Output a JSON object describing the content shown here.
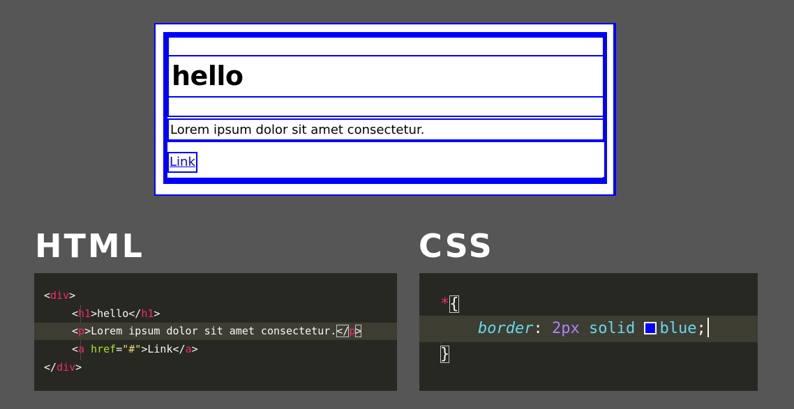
{
  "preview": {
    "heading": "hello",
    "paragraph": "Lorem ipsum dolor sit amet consectetur.",
    "link": "Link"
  },
  "sections": {
    "html_title": "HTML",
    "css_title": "CSS"
  },
  "html_code": {
    "line1": {
      "open": "<",
      "tag": "div",
      "close": ">"
    },
    "line2": {
      "open": "<",
      "tag": "h1",
      "close": ">",
      "text": "hello",
      "end_open": "</",
      "end_tag": "h1",
      "end_close": ">"
    },
    "line3": {
      "open": "<",
      "tag": "p",
      "close": ">",
      "text": "Lorem ipsum dolor sit amet consectetur.",
      "end_open": "</",
      "end_tag": "p",
      "end_close": ">"
    },
    "line4": {
      "open": "<",
      "tag": "a",
      "attr": " href",
      "eq": "=",
      "str": "\"#\"",
      "close": ">",
      "text": "Link",
      "end_open": "</",
      "end_tag": "a",
      "end_close": ">"
    },
    "line5": {
      "open": "</",
      "tag": "div",
      "close": ">"
    }
  },
  "css_code": {
    "selector": "*",
    "open_brace": "{",
    "property": "border",
    "colon": ":",
    "num": "2px",
    "keyword": "solid",
    "color_value": "blue",
    "semicolon": ";",
    "close_brace": "}"
  },
  "colors": {
    "background": "#565656",
    "editor_bg": "#272822",
    "border_blue": "#0000ff",
    "tag_pink": "#f92672",
    "attr_green": "#a6e22e",
    "string_yellow": "#e6db74",
    "prop_cyan": "#66d9ef",
    "number_purple": "#ae81ff"
  }
}
